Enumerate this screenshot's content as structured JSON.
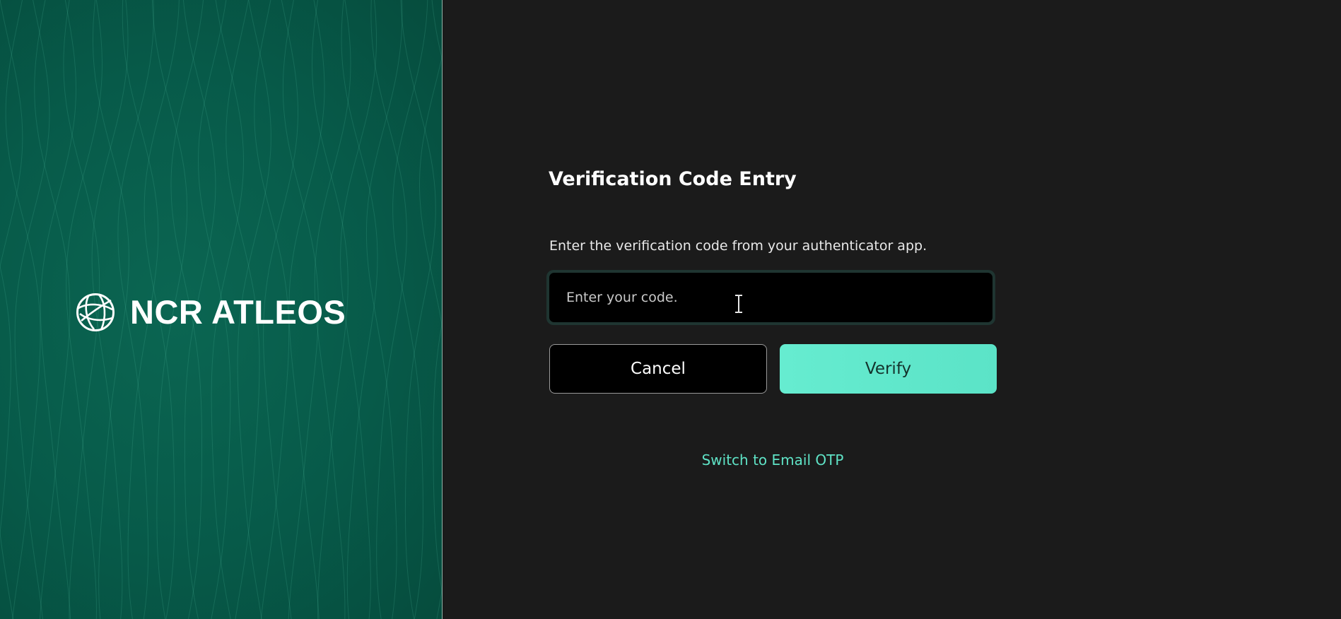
{
  "brand": {
    "logo_text": "NCR ATLEOS",
    "logo_icon": "globe-icon",
    "background_color": "#075a49",
    "accent_color": "#5be3c7"
  },
  "verification": {
    "title": "Verification Code Entry",
    "instructions": "Enter the verification code from your authenticator app.",
    "code_input": {
      "value": "",
      "placeholder": "Enter your code."
    },
    "cancel_label": "Cancel",
    "verify_label": "Verify",
    "switch_link_label": "Switch to Email OTP"
  }
}
